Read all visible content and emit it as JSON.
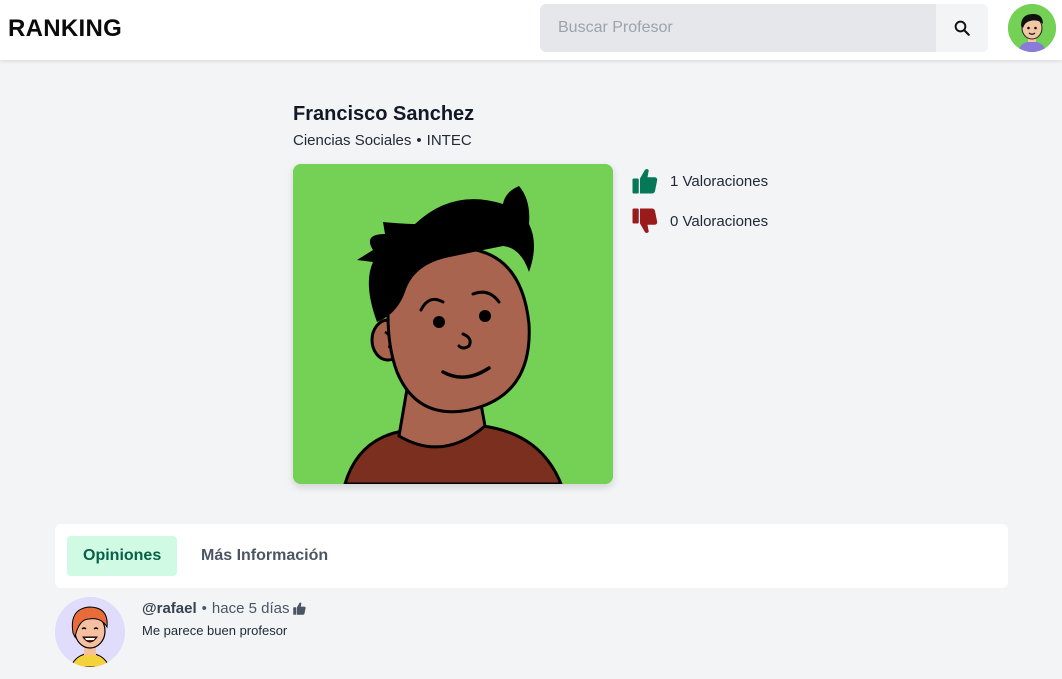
{
  "header": {
    "brand": "RANKING",
    "search_placeholder": "Buscar Profesor",
    "search_value": ""
  },
  "professor": {
    "name": "Francisco Sanchez",
    "department": "Ciencias Sociales",
    "separator": "•",
    "institution": "INTEC"
  },
  "ratings": {
    "likes_count": "1",
    "likes_label": "Valoraciones",
    "dislikes_count": "0",
    "dislikes_label": "Valoraciones"
  },
  "tabs": [
    {
      "label": "Opiniones",
      "active": true
    },
    {
      "label": "Más Información",
      "active": false
    }
  ],
  "comments": [
    {
      "user": "@rafael",
      "separator": "•",
      "time": "hace 5 días",
      "text": "Me parece buen profesor"
    }
  ],
  "colors": {
    "accent_green": "#047857",
    "dislike_red": "#991b1b",
    "avatar_bg": "#74d155",
    "active_tab_bg": "#d1fae5"
  },
  "icons": {
    "search": "search-icon",
    "like": "thumbs-up-icon",
    "dislike": "thumbs-down-icon"
  }
}
